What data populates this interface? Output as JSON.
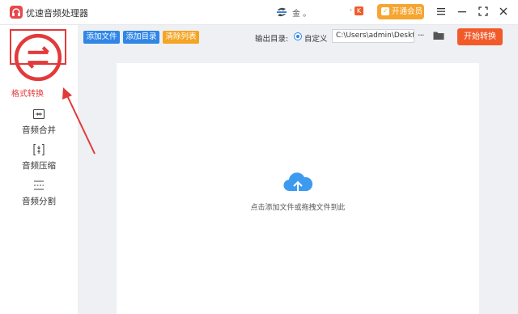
{
  "app": {
    "title": "优速音频处理器"
  },
  "user": {
    "name": "金 。",
    "badge": "K"
  },
  "header": {
    "vip_label": "开通会员"
  },
  "sidebar": {
    "items": [
      {
        "label": "格式转换",
        "icon": "format-convert-icon",
        "active": true
      },
      {
        "label": "音频合并",
        "icon": "audio-merge-icon"
      },
      {
        "label": "音频压缩",
        "icon": "audio-compress-icon"
      },
      {
        "label": "音频分割",
        "icon": "audio-split-icon"
      }
    ]
  },
  "toolbar": {
    "add_file": "添加文件",
    "add_folder": "添加目录",
    "clear_list": "清除列表",
    "output_label": "输出目录:",
    "radio_custom": "自定义",
    "output_path": "C:\\Users\\admin\\Desktop",
    "more": "···",
    "start": "开始转换"
  },
  "main": {
    "drop_hint": "点击添加文件或拖拽文件到此"
  },
  "colors": {
    "accent_blue": "#2f86e6",
    "clear_orange": "#f5a524",
    "start_red": "#f25a2a",
    "vip_gold": "#f6a531",
    "annotation_red": "#e23a3a"
  }
}
